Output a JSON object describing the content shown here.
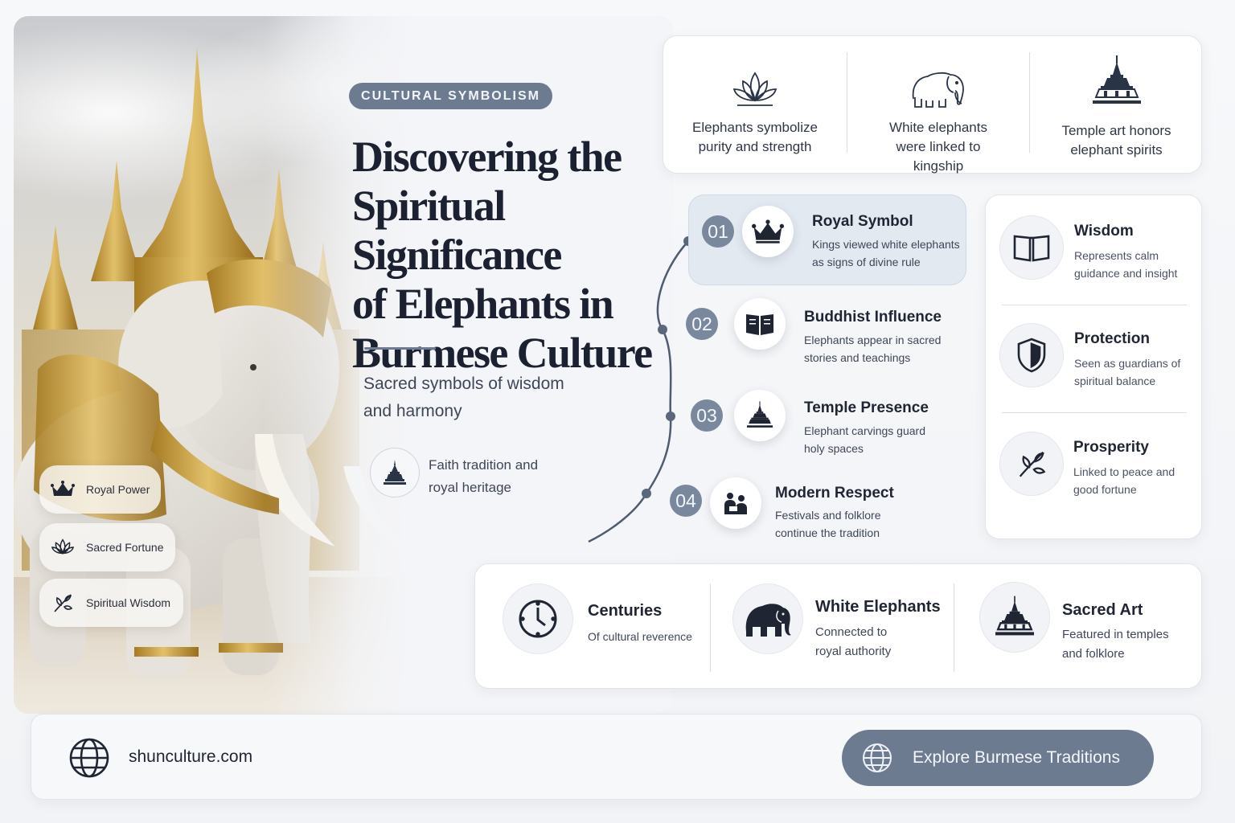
{
  "tag": "CULTURAL SYMBOLISM",
  "title_lines": [
    "Discovering the",
    "Spiritual Significance",
    "of Elephants in",
    "Burmese Culture"
  ],
  "subtitle": [
    "Sacred symbols of wisdom",
    "and harmony"
  ],
  "faith": {
    "icon": "temple-icon",
    "lines": [
      "Faith tradition and",
      "royal heritage"
    ]
  },
  "badges": [
    {
      "label": "Royal Power",
      "icon": "crown-icon"
    },
    {
      "label": "Sacred Fortune",
      "icon": "lotus-icon"
    },
    {
      "label": "Spiritual Wisdom",
      "icon": "leaf-icon"
    }
  ],
  "facts": [
    {
      "icon": "lotus-icon",
      "lines": [
        "Elephants symbolize",
        "purity and strength"
      ]
    },
    {
      "icon": "elephant-icon",
      "lines": [
        "White elephants",
        "were linked to",
        "kingship"
      ]
    },
    {
      "icon": "pagoda-icon",
      "lines": [
        "Temple art honors",
        "elephant spirits"
      ]
    }
  ],
  "timeline": [
    {
      "num": "01",
      "icon": "crown-icon",
      "title": "Royal Symbol",
      "desc": [
        "Kings viewed white elephants",
        "as signs of divine rule"
      ],
      "highlighted": true
    },
    {
      "num": "02",
      "icon": "book-icon",
      "title": "Buddhist Influence",
      "desc": [
        "Elephants appear in sacred",
        "stories and teachings"
      ],
      "highlighted": false
    },
    {
      "num": "03",
      "icon": "pagoda-icon",
      "title": "Temple Presence",
      "desc": [
        "Elephant carvings guard",
        "holy spaces"
      ],
      "highlighted": false
    },
    {
      "num": "04",
      "icon": "people-icon",
      "title": "Modern Respect",
      "desc": [
        "Festivals and folklore",
        "continue the tradition"
      ],
      "highlighted": false
    }
  ],
  "values": [
    {
      "icon": "book-icon",
      "title": "Wisdom",
      "desc": [
        "Represents calm",
        "guidance and insight"
      ]
    },
    {
      "icon": "shield-icon",
      "title": "Protection",
      "desc": [
        "Seen as guardians of",
        "spiritual balance"
      ]
    },
    {
      "icon": "leaf-icon",
      "title": "Prosperity",
      "desc": [
        "Linked to peace and",
        "good fortune"
      ]
    }
  ],
  "stats": [
    {
      "icon": "clock-icon",
      "title": "Centuries",
      "desc": [
        "Of cultural reverence"
      ]
    },
    {
      "icon": "elephant-icon",
      "title": "White Elephants",
      "desc": [
        "Connected to",
        "royal authority"
      ]
    },
    {
      "icon": "pagoda-icon",
      "title": "Sacred Art",
      "desc": [
        "Featured in temples",
        "and folklore"
      ]
    }
  ],
  "footer": {
    "site": "shunculture.com",
    "cta": "Explore Burmese Traditions",
    "globe_icon": "globe-icon"
  },
  "colors": {
    "accent": "#6d7b91",
    "ink": "#1f2533",
    "gold": "#c9a23a",
    "elephant": "#ece9e4"
  }
}
